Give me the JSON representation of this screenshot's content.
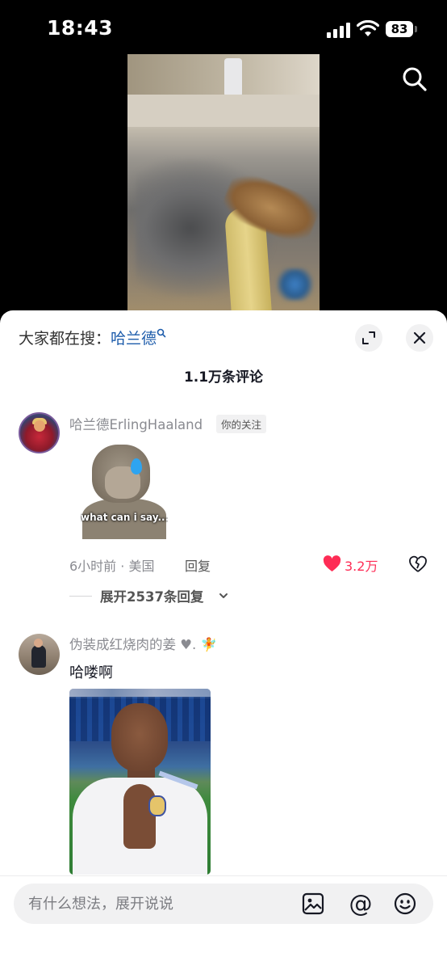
{
  "status_bar": {
    "time": "18:43",
    "battery": "83"
  },
  "sheet": {
    "trending_prefix": "大家都在搜：",
    "trending_keyword": "哈兰德",
    "comment_count": "1.1万条评论"
  },
  "comments": [
    {
      "username": "哈兰德ErlingHaaland",
      "tag": "你的关注",
      "sticker_caption": "what can i say...",
      "time_location": "6小时前 · 美国",
      "reply_label": "回复",
      "likes": "3.2万",
      "expand_replies": "展开2537条回复"
    },
    {
      "username": "伪装成红烧肉的姜",
      "username_suffix": ". 🧚",
      "text": "哈喽啊"
    }
  ],
  "input": {
    "placeholder": "有什么想法，展开说说"
  },
  "colors": {
    "accent_red": "#fe2c55",
    "keyword_blue": "#1d5cab"
  }
}
